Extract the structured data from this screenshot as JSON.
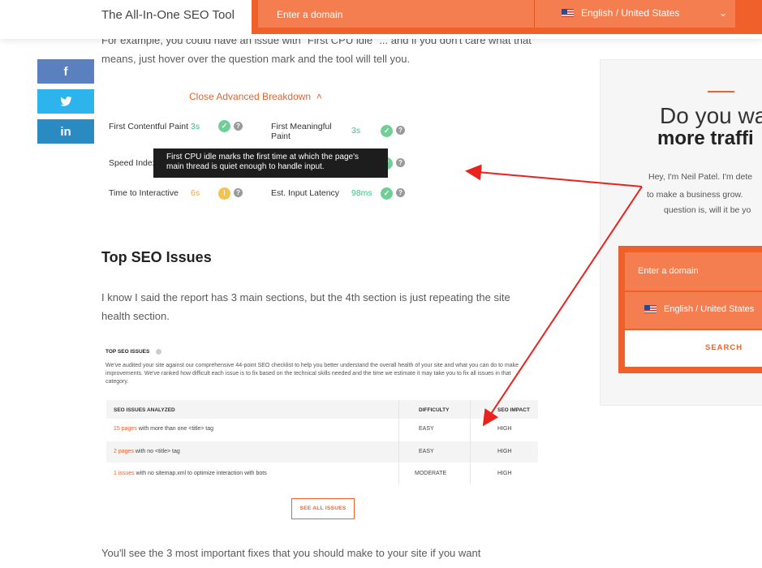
{
  "header": {
    "brand": "The All-In-One SEO Tool",
    "domain_placeholder": "Enter a domain",
    "language": "English / United States",
    "chevron": "⌄"
  },
  "share": {
    "facebook": "f",
    "twitter": "t",
    "linkedin": "in"
  },
  "article": {
    "para1": "For example, you could have an issue with \"First CPU idle\" ... and if you don't care what that means, just hover over the question mark and the tool will tell you.",
    "close_breakdown": "Close Advanced Breakdown",
    "metrics": {
      "fcp_label": "First Contentful Paint",
      "fcp_value": "3s",
      "fmp_label": "First Meaningful Paint",
      "fmp_value": "3s",
      "speed_label": "Speed Index",
      "tti_label": "Time to Interactive",
      "tti_value": "6s",
      "eil_label": "Est. Input Latency",
      "eil_value": "98ms"
    },
    "tooltip": "First CPU idle marks the first time at which the page's main thread is quiet enough to handle input.",
    "section_title": "Top SEO Issues",
    "para2": "I know I said the report has 3 main sections, but the 4th section is just repeating the site health section.",
    "para3": "You'll see the 3 most important fixes that you should make to your site if you want"
  },
  "report": {
    "title": "TOP SEO ISSUES",
    "description": "We've audited your site against our comprehensive 44-point SEO checklist to help you better understand the overall health of your site and what you can do to make improvements. We've ranked how difficult each issue is to fix based on the technical skills needed and the time we estimate it may take you to fix all issues in that category.",
    "columns": [
      "SEO ISSUES ANALYZED",
      "DIFFICULTY",
      "SEO IMPACT"
    ],
    "rows": [
      {
        "link": "15 pages",
        "text": " with more than one <title> tag",
        "difficulty": "EASY",
        "impact": "HIGH"
      },
      {
        "link": "2 pages",
        "text": " with no <title> tag",
        "difficulty": "EASY",
        "impact": "HIGH"
      },
      {
        "link": "1 issues",
        "text": " with no sitemap.xml to optimize interaction with bots",
        "difficulty": "MODERATE",
        "impact": "HIGH"
      }
    ],
    "see_all": "SEE ALL ISSUES"
  },
  "sidebar": {
    "heading1": "Do you wa",
    "heading2": "more traffi",
    "text1": "Hey, I'm Neil Patel. I'm dete",
    "text2": "to make a business grow.",
    "text3": "question is, will it be yo",
    "domain_placeholder": "Enter a domain",
    "language": "English / United States",
    "search": "SEARCH"
  },
  "colors": {
    "accent": "#f0602a",
    "green": "#3cc38a",
    "warning": "#f5c24b"
  }
}
